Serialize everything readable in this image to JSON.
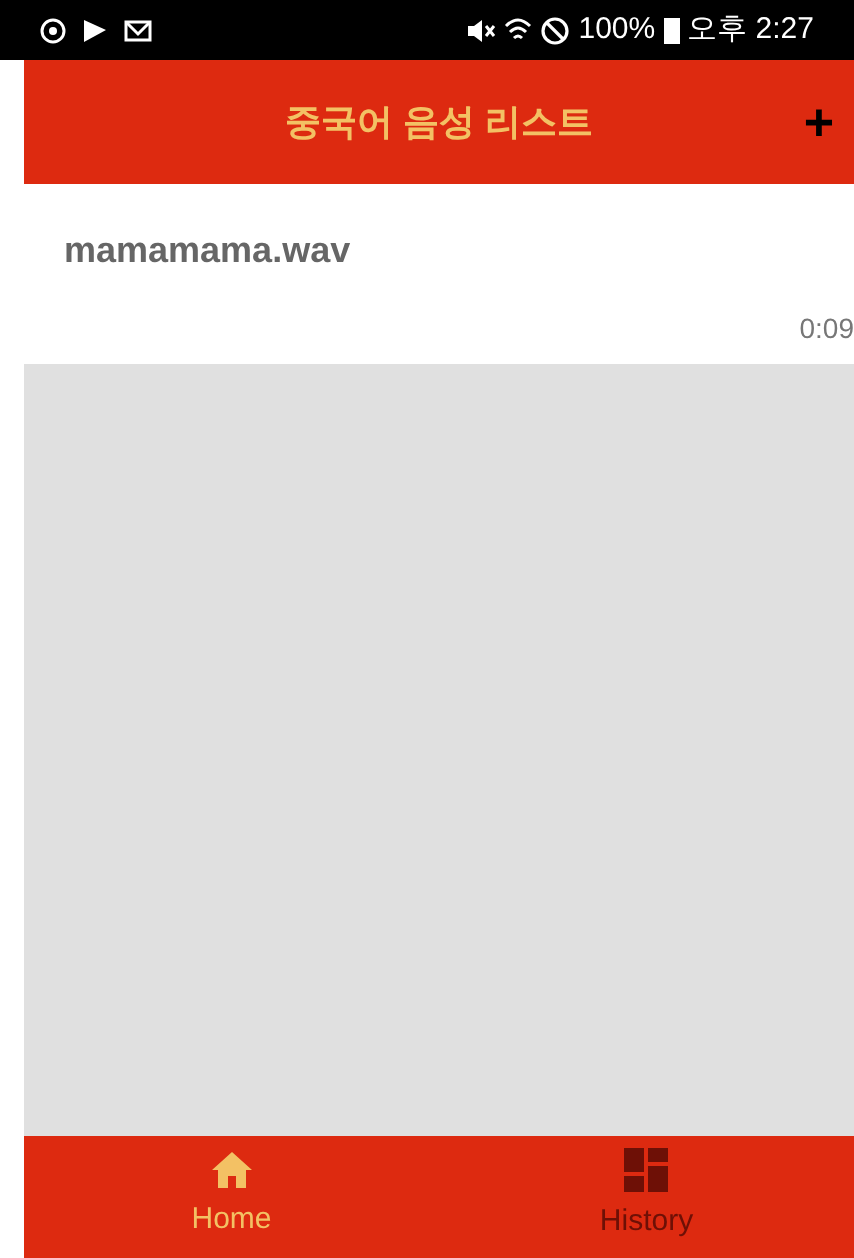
{
  "status_bar": {
    "battery": "100%",
    "time": "오후 2:27"
  },
  "header": {
    "title": "중국어 음성 리스트",
    "action": "+"
  },
  "files": [
    {
      "name": "mamamama.wav",
      "duration": "0:09"
    }
  ],
  "nav": [
    {
      "label": "Home",
      "selected": true,
      "kind": "home"
    },
    {
      "label": "History",
      "selected": false,
      "kind": "history"
    }
  ]
}
